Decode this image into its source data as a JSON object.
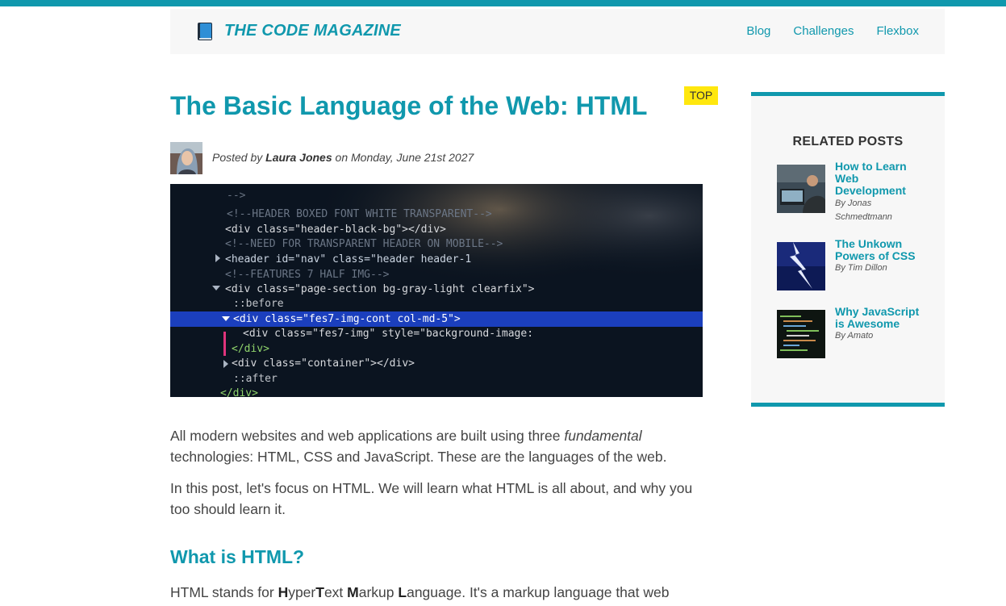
{
  "header": {
    "brand": "THE CODE MAGAZINE",
    "logo_icon": "book-icon",
    "nav": [
      "Blog",
      "Challenges",
      "Flexbox"
    ]
  },
  "post": {
    "tag": "TOP",
    "title": "The Basic Language of the Web: HTML",
    "byline_prefix": "Posted by",
    "author": "Laura Jones",
    "byline_suffix": "on Monday, June 21st 2027",
    "hero_code_lines": [
      "-->",
      "<!--HEADER BOXED FONT WHITE TRANSPARENT-->",
      "<div class=\"header-black-bg\"></div>",
      "<!--NEED FOR TRANSPARENT HEADER ON MOBILE-->",
      "<header id=\"nav\" class=\"header header-1",
      "<!--FEATURES 7 HALF IMG-->",
      "<div class=\"page-section bg-gray-light clearfix\">",
      "::before",
      "<div class=\"fes7-img-cont col-md-5\">",
      "<div class=\"fes7-img\" style=\"background-image:",
      "</div>",
      "<div class=\"container\"></div>",
      "::after",
      "</div>"
    ],
    "p1_before": "All modern websites and web applications are built using three ",
    "p1_em": "fundamental",
    "p1_after": " technologies: HTML, CSS and JavaScript. These are the languages of the web.",
    "p2": "In this post, let's focus on HTML. We will learn what HTML is all about, and why you too should learn it.",
    "h2": "What is HTML?",
    "p3_parts": [
      "H",
      "yper",
      "T",
      "ext ",
      "M",
      "arkup ",
      "L",
      "anguage. It's a markup language that web"
    ],
    "p3_prefix": "HTML stands for "
  },
  "aside": {
    "title": "RELATED POSTS",
    "posts": [
      {
        "title": "How to Learn Web Development",
        "author": "By Jonas Schmedtmann"
      },
      {
        "title": "The Unkown Powers of CSS",
        "author": "By Tim Dillon"
      },
      {
        "title": "Why JavaScript is Awesome",
        "author": "By Amato"
      }
    ]
  },
  "colors": {
    "accent": "#1098ad",
    "tag_bg": "#ffe70e",
    "header_bg": "#f7f7f7"
  }
}
